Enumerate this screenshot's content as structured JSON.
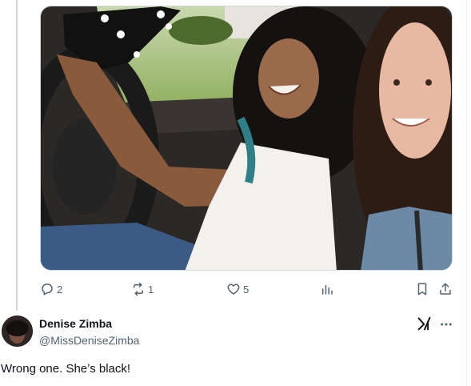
{
  "tweet": {
    "media": {
      "kind": "photo"
    },
    "actions": {
      "replies": "2",
      "reposts": "1",
      "likes": "5",
      "views": ""
    }
  },
  "reply": {
    "name": "Denise Zimba",
    "handle": "@MissDeniseZimba",
    "text": "Wrong one. She’s black!"
  },
  "icons": {
    "reply": "reply-icon",
    "repost": "repost-icon",
    "like": "heart-icon",
    "views": "analytics-icon",
    "bookmark": "bookmark-icon",
    "share": "share-icon",
    "grok": "grok-icon",
    "more": "more-icon"
  },
  "colors": {
    "icon_gray": "#536471",
    "text": "#0f1419",
    "border": "#cfd9de"
  }
}
